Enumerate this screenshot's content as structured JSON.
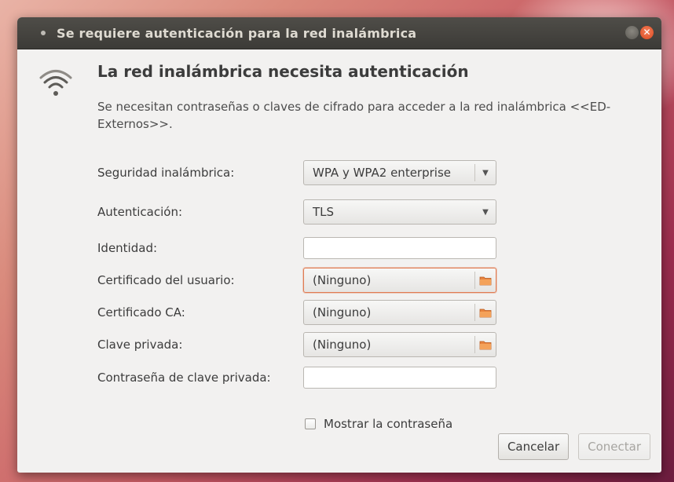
{
  "window": {
    "title": "Se requiere autenticación para la red inalámbrica"
  },
  "dialog": {
    "heading": "La red inalámbrica necesita autenticación",
    "description": "Se necesitan contraseñas o claves de cifrado para acceder a la red inalámbrica <<ED-Externos>>."
  },
  "form": {
    "security": {
      "label": "Seguridad inalámbrica:",
      "value": "WPA y WPA2 enterprise"
    },
    "authentication": {
      "label": "Autenticación:",
      "value": "TLS"
    },
    "identity": {
      "label": "Identidad:",
      "value": ""
    },
    "user_cert": {
      "label": "Certificado del usuario:",
      "value": "(Ninguno)"
    },
    "ca_cert": {
      "label": "Certificado CA:",
      "value": "(Ninguno)"
    },
    "private_key": {
      "label": "Clave privada:",
      "value": "(Ninguno)"
    },
    "private_key_password": {
      "label": "Contraseña de clave privada:",
      "value": ""
    },
    "show_password": {
      "label": "Mostrar la contraseña",
      "checked": false
    }
  },
  "buttons": {
    "cancel": "Cancelar",
    "connect": "Conectar"
  },
  "icons": {
    "network": "wifi-icon",
    "file": "folder-icon",
    "close": "close-icon",
    "minimize": "minimize-icon",
    "dropdown": "chevron-down-icon"
  },
  "colors": {
    "accent": "#dd4814",
    "titlebar": "#3c3b37",
    "window_bg": "#f2f1f0"
  }
}
